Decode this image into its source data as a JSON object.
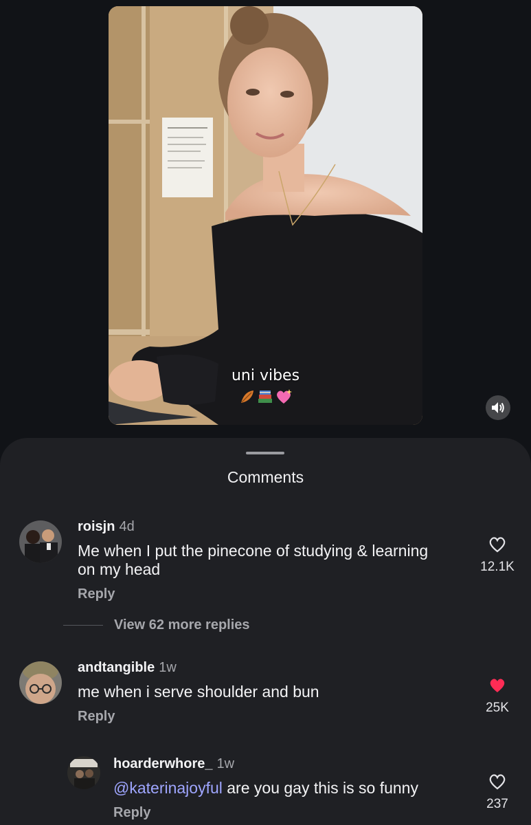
{
  "video": {
    "caption": "uni vibes",
    "caption_emojis": [
      "leaf-emoji",
      "books-emoji",
      "sparkling-heart-emoji"
    ]
  },
  "sheet": {
    "title": "Comments"
  },
  "comments": [
    {
      "username": "roisjn",
      "time": "4d",
      "text": "Me when I put the pinecone of studying & learning on my head",
      "reply_label": "Reply",
      "likes": "12.1K",
      "liked": false,
      "view_more": "View 62 more replies"
    },
    {
      "username": "andtangible",
      "time": "1w",
      "text": "me when i serve shoulder and bun",
      "reply_label": "Reply",
      "likes": "25K",
      "liked": true
    },
    {
      "username": "hoarderwhore_",
      "time": "1w",
      "mention": "@katerinajoyful",
      "text": " are you gay this is so funny",
      "reply_label": "Reply",
      "likes": "237",
      "liked": false
    }
  ],
  "colors": {
    "background": "#111317",
    "sheet": "#1f2024",
    "mention": "#9fa6ff",
    "liked_heart": "#fe2c55"
  }
}
